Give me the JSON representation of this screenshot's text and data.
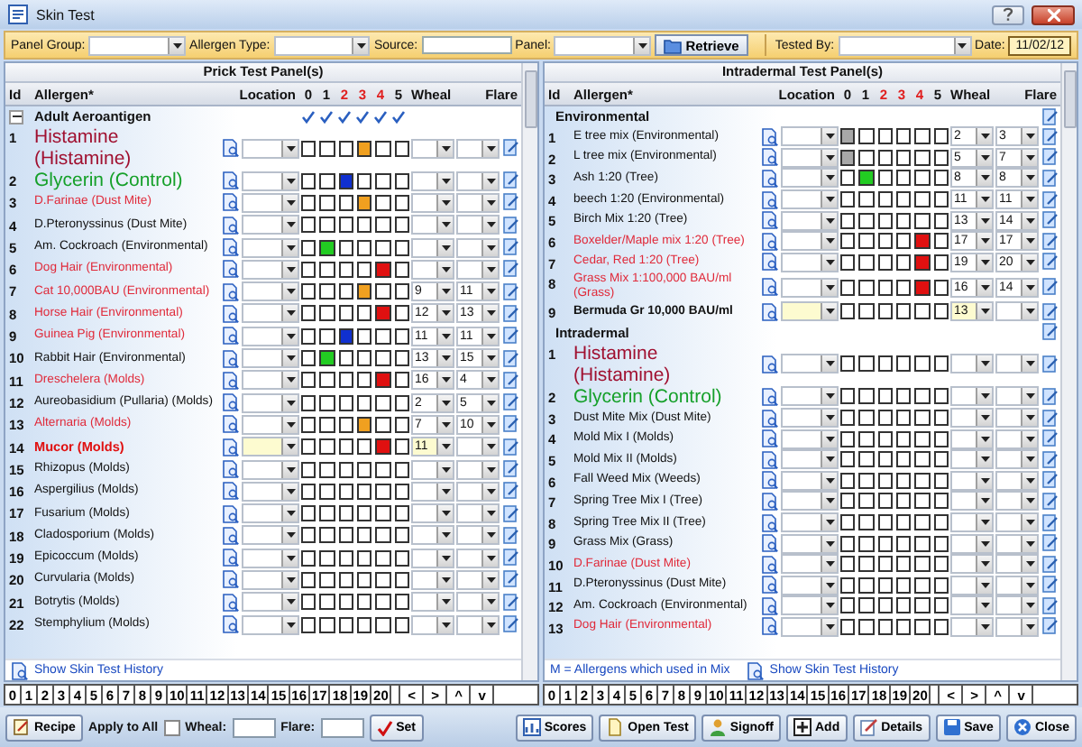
{
  "window": {
    "title": "Skin Test"
  },
  "filters": [
    {
      "label": "Panel Group:",
      "kind": "select"
    },
    {
      "label": "Allergen Type:",
      "kind": "select"
    },
    {
      "label": "Source:",
      "kind": "text"
    },
    {
      "label": "Panel:",
      "kind": "select"
    }
  ],
  "retrieve": "Retrieve",
  "tested_by": {
    "label": "Tested By:"
  },
  "date": {
    "label": "Date:",
    "value": "11/02/12"
  },
  "left": {
    "title": "Prick Test Panel(s)",
    "columns": {
      "id": "Id",
      "allergen": "Allergen*",
      "location": "Location",
      "grades": [
        {
          "label": "0",
          "kind": "plain"
        },
        {
          "label": "1",
          "kind": "plain"
        },
        {
          "label": "2",
          "kind": "reactive"
        },
        {
          "label": "3",
          "kind": "reactive"
        },
        {
          "label": "4",
          "kind": "reactive"
        },
        {
          "label": "5",
          "kind": "plain"
        }
      ],
      "wheal": "Wheal",
      "flare": "Flare"
    },
    "number_strip": [
      "0",
      "1",
      "2",
      "3",
      "4",
      "5",
      "6",
      "7",
      "8",
      "9",
      "10",
      "11",
      "12",
      "13",
      "14",
      "15",
      "16",
      "17",
      "18",
      "19",
      "20"
    ],
    "nav_keys": [
      "<",
      ">",
      "^",
      "v"
    ],
    "groups": [
      {
        "title": "Adult Aeroantigen",
        "expanded": true,
        "checks": true,
        "rows": [
          {
            "id": "1",
            "name": "Histamine (Histamine)",
            "kind": "histamine",
            "marks": [
              false,
              false,
              false,
              true,
              false,
              false
            ],
            "current": false
          },
          {
            "id": "2",
            "name": "Glycerin (Control)",
            "kind": "glycerin",
            "marks": [
              false,
              false,
              true,
              false,
              false,
              false
            ],
            "current": false
          },
          {
            "id": "3",
            "name": "D.Farinae (Dust Mite)",
            "kind": "positive",
            "marks": [
              false,
              false,
              false,
              true,
              false,
              false
            ],
            "current": false
          },
          {
            "id": "4",
            "name": "D.Pteronyssinus (Dust Mite)",
            "kind": "normal",
            "marks": [
              false,
              false,
              false,
              false,
              false,
              false
            ],
            "current": false
          },
          {
            "id": "5",
            "name": "Am. Cockroach (Environmental)",
            "kind": "normal",
            "marks": [
              false,
              true,
              false,
              false,
              false,
              false
            ],
            "current": false
          },
          {
            "id": "6",
            "name": "Dog Hair (Environmental)",
            "kind": "positive",
            "marks": [
              false,
              false,
              false,
              false,
              true,
              false
            ],
            "current": false
          },
          {
            "id": "7",
            "name": "Cat 10,000BAU (Environmental)",
            "kind": "positive",
            "marks": [
              false,
              false,
              false,
              true,
              false,
              false
            ],
            "wheal": "9",
            "flare": "11",
            "current": false
          },
          {
            "id": "8",
            "name": "Horse Hair (Environmental)",
            "kind": "positive",
            "marks": [
              false,
              false,
              false,
              false,
              true,
              false
            ],
            "wheal": "12",
            "flare": "13",
            "current": false
          },
          {
            "id": "9",
            "name": "Guinea Pig (Environmental)",
            "kind": "positive",
            "marks": [
              false,
              false,
              true,
              false,
              false,
              false
            ],
            "wheal": "11",
            "flare": "11",
            "current": false
          },
          {
            "id": "10",
            "name": "Rabbit Hair (Environmental)",
            "kind": "normal",
            "marks": [
              false,
              true,
              false,
              false,
              false,
              false
            ],
            "wheal": "13",
            "flare": "15",
            "current": false
          },
          {
            "id": "11",
            "name": "Dreschelera (Molds)",
            "kind": "positive",
            "marks": [
              false,
              false,
              false,
              false,
              true,
              false
            ],
            "wheal": "16",
            "flare": "4",
            "current": false
          },
          {
            "id": "12",
            "name": "Aureobasidium (Pullaria) (Molds)",
            "kind": "normal",
            "marks": [
              false,
              false,
              false,
              false,
              false,
              false
            ],
            "wheal": "2",
            "flare": "5",
            "current": false
          },
          {
            "id": "13",
            "name": "Alternaria  (Molds)",
            "kind": "positive",
            "marks": [
              false,
              false,
              false,
              true,
              false,
              false
            ],
            "wheal": "7",
            "flare": "10",
            "current": false
          },
          {
            "id": "14",
            "name": "Mucor (Molds)",
            "kind": "highlight",
            "marks": [
              false,
              false,
              false,
              false,
              true,
              false
            ],
            "wheal": "11",
            "current": true
          },
          {
            "id": "15",
            "name": "Rhizopus (Molds)",
            "kind": "normal",
            "marks": [
              false,
              false,
              false,
              false,
              false,
              false
            ],
            "current": false
          },
          {
            "id": "16",
            "name": "Aspergilius  (Molds)",
            "kind": "normal",
            "marks": [
              false,
              false,
              false,
              false,
              false,
              false
            ],
            "current": false
          },
          {
            "id": "17",
            "name": "Fusarium  (Molds)",
            "kind": "normal",
            "marks": [
              false,
              false,
              false,
              false,
              false,
              false
            ],
            "current": false
          },
          {
            "id": "18",
            "name": "Cladosporium (Molds)",
            "kind": "normal",
            "marks": [
              false,
              false,
              false,
              false,
              false,
              false
            ],
            "current": false
          },
          {
            "id": "19",
            "name": "Epicoccum (Molds)",
            "kind": "normal",
            "marks": [
              false,
              false,
              false,
              false,
              false,
              false
            ],
            "current": false
          },
          {
            "id": "20",
            "name": "Curvularia (Molds)",
            "kind": "normal",
            "marks": [
              false,
              false,
              false,
              false,
              false,
              false
            ],
            "current": false
          },
          {
            "id": "21",
            "name": "Botrytis (Molds)",
            "kind": "normal",
            "marks": [
              false,
              false,
              false,
              false,
              false,
              false
            ],
            "current": false
          },
          {
            "id": "22",
            "name": "Stemphylium (Molds)",
            "kind": "normal",
            "marks": [
              false,
              false,
              false,
              false,
              false,
              false
            ],
            "current": false
          }
        ]
      }
    ],
    "footer": [
      {
        "text": "Show Skin Test History",
        "kind": "link"
      }
    ]
  },
  "right": {
    "title": "Intradermal Test Panel(s)",
    "columns": {
      "id": "Id",
      "allergen": "Allergen*",
      "location": "Location",
      "grades": [
        {
          "label": "0",
          "kind": "plain"
        },
        {
          "label": "1",
          "kind": "plain"
        },
        {
          "label": "2",
          "kind": "reactive"
        },
        {
          "label": "3",
          "kind": "reactive"
        },
        {
          "label": "4",
          "kind": "reactive"
        },
        {
          "label": "5",
          "kind": "plain"
        }
      ],
      "wheal": "Wheal",
      "flare": "Flare"
    },
    "number_strip": [
      "0",
      "1",
      "2",
      "3",
      "4",
      "5",
      "6",
      "7",
      "8",
      "9",
      "10",
      "11",
      "12",
      "13",
      "14",
      "15",
      "16",
      "17",
      "18",
      "19",
      "20"
    ],
    "nav_keys": [
      "<",
      ">",
      "^",
      "v"
    ],
    "groups": [
      {
        "title": "Environmental",
        "checks": false,
        "rows": [
          {
            "id": "1",
            "name": "E tree mix (Environmental)",
            "kind": "normal",
            "marks": [
              true,
              false,
              false,
              false,
              false,
              false
            ],
            "wheal": "2",
            "flare": "3",
            "current": false
          },
          {
            "id": "2",
            "name": "L tree mix (Environmental)",
            "kind": "normal",
            "marks": [
              true,
              false,
              false,
              false,
              false,
              false
            ],
            "wheal": "5",
            "flare": "7",
            "current": false
          },
          {
            "id": "3",
            "name": "Ash 1:20  (Tree)",
            "kind": "normal",
            "marks": [
              false,
              true,
              false,
              false,
              false,
              false
            ],
            "wheal": "8",
            "flare": "8",
            "current": false
          },
          {
            "id": "4",
            "name": "beech 1:20 (Environmental)",
            "kind": "normal",
            "marks": [
              false,
              false,
              false,
              false,
              false,
              false
            ],
            "wheal": "11",
            "flare": "11",
            "current": false
          },
          {
            "id": "5",
            "name": "Birch Mix 1:20 (Tree)",
            "kind": "normal",
            "marks": [
              false,
              false,
              false,
              false,
              false,
              false
            ],
            "wheal": "13",
            "flare": "14",
            "current": false
          },
          {
            "id": "6",
            "name": "Boxelder/Maple mix 1:20 (Tree)",
            "kind": "positive",
            "marks": [
              false,
              false,
              false,
              false,
              true,
              false
            ],
            "wheal": "17",
            "flare": "17",
            "current": false
          },
          {
            "id": "7",
            "name": "Cedar, Red  1:20 (Tree)",
            "kind": "positive",
            "marks": [
              false,
              false,
              false,
              false,
              true,
              false
            ],
            "wheal": "19",
            "flare": "20",
            "current": false
          },
          {
            "id": "8",
            "name": "Grass Mix 1:100,000 BAU/ml (Grass)",
            "kind": "positive",
            "marks": [
              false,
              false,
              false,
              false,
              true,
              false
            ],
            "wheal": "16",
            "flare": "14",
            "current": false
          },
          {
            "id": "9",
            "name": "Bermuda Gr 10,000 BAU/ml",
            "kind": "bold",
            "marks": [
              false,
              false,
              false,
              false,
              false,
              false
            ],
            "wheal": "13",
            "current": true
          }
        ]
      },
      {
        "title": "Intradermal",
        "checks": false,
        "rows": [
          {
            "id": "1",
            "name": "Histamine (Histamine)",
            "kind": "histamine",
            "marks": [
              false,
              false,
              false,
              false,
              false,
              false
            ],
            "current": false
          },
          {
            "id": "2",
            "name": "Glycerin (Control)",
            "kind": "glycerin",
            "marks": [
              false,
              false,
              false,
              false,
              false,
              false
            ],
            "current": false
          },
          {
            "id": "3",
            "name": "Dust Mite Mix (Dust Mite)",
            "kind": "normal",
            "marks": [
              false,
              false,
              false,
              false,
              false,
              false
            ],
            "current": false
          },
          {
            "id": "4",
            "name": "Mold Mix I (Molds)",
            "kind": "normal",
            "marks": [
              false,
              false,
              false,
              false,
              false,
              false
            ],
            "current": false
          },
          {
            "id": "5",
            "name": "Mold Mix II (Molds)",
            "kind": "normal",
            "marks": [
              false,
              false,
              false,
              false,
              false,
              false
            ],
            "current": false
          },
          {
            "id": "6",
            "name": "Fall Weed Mix (Weeds)",
            "kind": "normal",
            "marks": [
              false,
              false,
              false,
              false,
              false,
              false
            ],
            "current": false
          },
          {
            "id": "7",
            "name": "Spring Tree Mix I (Tree)",
            "kind": "normal",
            "marks": [
              false,
              false,
              false,
              false,
              false,
              false
            ],
            "current": false
          },
          {
            "id": "8",
            "name": "Spring Tree Mix II (Tree)",
            "kind": "normal",
            "marks": [
              false,
              false,
              false,
              false,
              false,
              false
            ],
            "current": false
          },
          {
            "id": "9",
            "name": "Grass Mix (Grass)",
            "kind": "normal",
            "marks": [
              false,
              false,
              false,
              false,
              false,
              false
            ],
            "current": false
          },
          {
            "id": "10",
            "name": "D.Farinae  (Dust Mite)",
            "kind": "positive",
            "marks": [
              false,
              false,
              false,
              false,
              false,
              false
            ],
            "current": false
          },
          {
            "id": "11",
            "name": "D.Pteronyssinus (Dust Mite)",
            "kind": "normal",
            "marks": [
              false,
              false,
              false,
              false,
              false,
              false
            ],
            "current": false
          },
          {
            "id": "12",
            "name": "Am. Cockroach  (Environmental)",
            "kind": "normal",
            "marks": [
              false,
              false,
              false,
              false,
              false,
              false
            ],
            "current": false
          },
          {
            "id": "13",
            "name": "Dog Hair (Environmental)",
            "kind": "positive",
            "marks": [
              false,
              false,
              false,
              false,
              false,
              false
            ],
            "current": false
          }
        ]
      }
    ],
    "footer": [
      {
        "text": "M = Allergens which used in Mix",
        "kind": "note"
      },
      {
        "text": "Show Skin Test History",
        "kind": "link"
      }
    ]
  },
  "bottom": {
    "recipe": "Recipe",
    "apply_all": {
      "label": "Apply to All",
      "checked": false
    },
    "wheal": "Wheal:",
    "flare": "Flare:",
    "set": "Set",
    "buttons": [
      {
        "label": "Scores",
        "kind": "scores"
      },
      {
        "label": "Open Test",
        "kind": "open"
      },
      {
        "label": "Signoff",
        "kind": "signoff"
      },
      {
        "label": "Add",
        "kind": "add"
      },
      {
        "label": "Details",
        "kind": "details"
      },
      {
        "label": "Save",
        "kind": "save"
      },
      {
        "label": "Close",
        "kind": "close"
      }
    ]
  }
}
